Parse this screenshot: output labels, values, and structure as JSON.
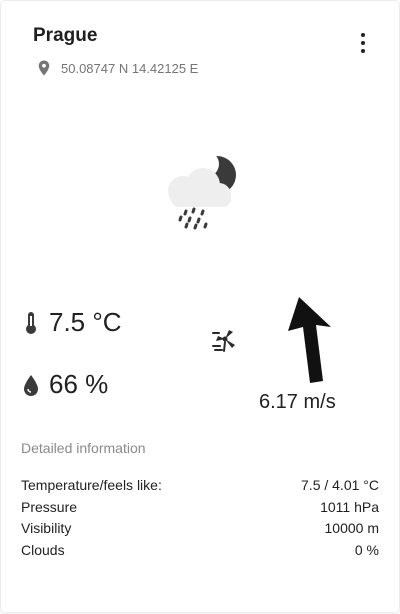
{
  "location": {
    "name": "Prague",
    "coordinates": "50.08747 N 14.42125 E"
  },
  "icons": {
    "location": "map-pin-icon",
    "menu": "more-vert-icon",
    "weather": "cloudy-night-rain-icon",
    "temperature": "thermometer-icon",
    "humidity": "water-drop-icon",
    "wind": "wind-turbine-icon",
    "wind_direction": "wind-direction-arrow-icon"
  },
  "current": {
    "temperature": "7.5 °C",
    "humidity": "66 %",
    "wind_speed": "6.17 m/s"
  },
  "details": {
    "heading": "Detailed information",
    "rows": [
      {
        "label": "Temperature/feels like:",
        "value": "7.5 / 4.01 °C"
      },
      {
        "label": "Pressure",
        "value": "1011 hPa"
      },
      {
        "label": "Visibility",
        "value": "10000 m"
      },
      {
        "label": "Clouds",
        "value": "0 %"
      }
    ]
  }
}
